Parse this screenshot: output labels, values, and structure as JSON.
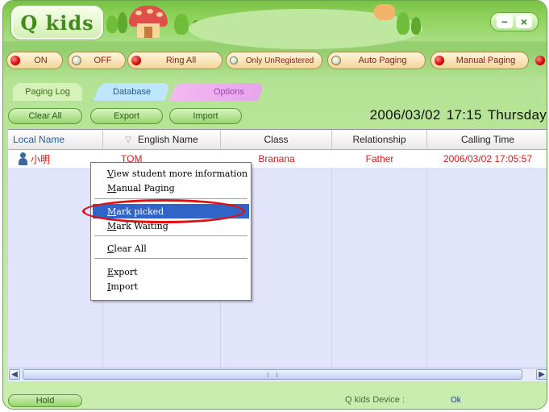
{
  "app": {
    "logo_text": "Q kids",
    "window_buttons": {
      "minimize": "−",
      "close": "×"
    }
  },
  "paging_buttons": [
    {
      "label": "ON",
      "led": "red"
    },
    {
      "label": "OFF",
      "led": "off"
    },
    {
      "label": "Ring All",
      "led": "red"
    },
    {
      "label": "Only UnRegistered",
      "led": "green"
    },
    {
      "label": "Auto Paging",
      "led": "off"
    },
    {
      "label": "Manual Paging",
      "led": "red"
    }
  ],
  "tabs": {
    "paging_log": "Paging Log",
    "database": "Database",
    "options": "Options"
  },
  "toolbar": {
    "clear_all": "Clear All",
    "export": "Export",
    "import": "Import"
  },
  "datetime": {
    "date": "2006/03/02",
    "time": "17:15",
    "day": "Thursday"
  },
  "table": {
    "columns": [
      "Local Name",
      "English Name",
      "Class",
      "Relationship",
      "Calling Time"
    ],
    "sort_indicator": "▽",
    "rows": [
      {
        "local_name": "小明",
        "english_name": "TOM",
        "class": "Branana",
        "relationship": "Father",
        "calling_time": "2006/03/02 17:05:57"
      }
    ]
  },
  "context_menu": {
    "items": [
      {
        "mnemonic": "V",
        "rest": "iew student more information"
      },
      {
        "mnemonic": "M",
        "rest": "anual Paging"
      },
      {
        "mnemonic": "M",
        "rest": "ark picked"
      },
      {
        "mnemonic": "M",
        "rest": "ark Waiting"
      },
      {
        "mnemonic": "C",
        "rest": "lear All"
      },
      {
        "mnemonic": "E",
        "rest": "xport"
      },
      {
        "mnemonic": "I",
        "rest": "mport"
      }
    ]
  },
  "status": {
    "hold": "Hold",
    "device_label": "Q kids Device :",
    "device_value": "Ok"
  },
  "colors": {
    "accent_green": "#93cf6e",
    "highlight_blue": "#3064c8",
    "annotation_red": "#e01010",
    "row_text_red": "#d81818"
  }
}
